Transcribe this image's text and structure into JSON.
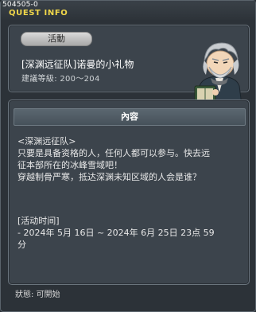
{
  "window": {
    "quest_id": "504505-0",
    "title": "QUEST INFO"
  },
  "summary": {
    "category_badge": "活動",
    "quest_name": "[深渊远征队]诺曼的小礼物",
    "level_text": "建議等級: 200～204"
  },
  "content": {
    "header": "內容",
    "lines": [
      "<深渊远征队>",
      "只要是具备资格的人，任何人都可以参与。快去远",
      "征本部所在的冰峰雪域吧！",
      "穿越制骨严寒，抵达深渊未知区域的人会是谁？"
    ],
    "time_label": "[活动时间]",
    "time_line1": " - 2024年 5月 16日 ~ 2024年 6月 25日 23点 59",
    "time_line2": "分"
  },
  "footer": {
    "status_text": "狀態: 可開始"
  }
}
